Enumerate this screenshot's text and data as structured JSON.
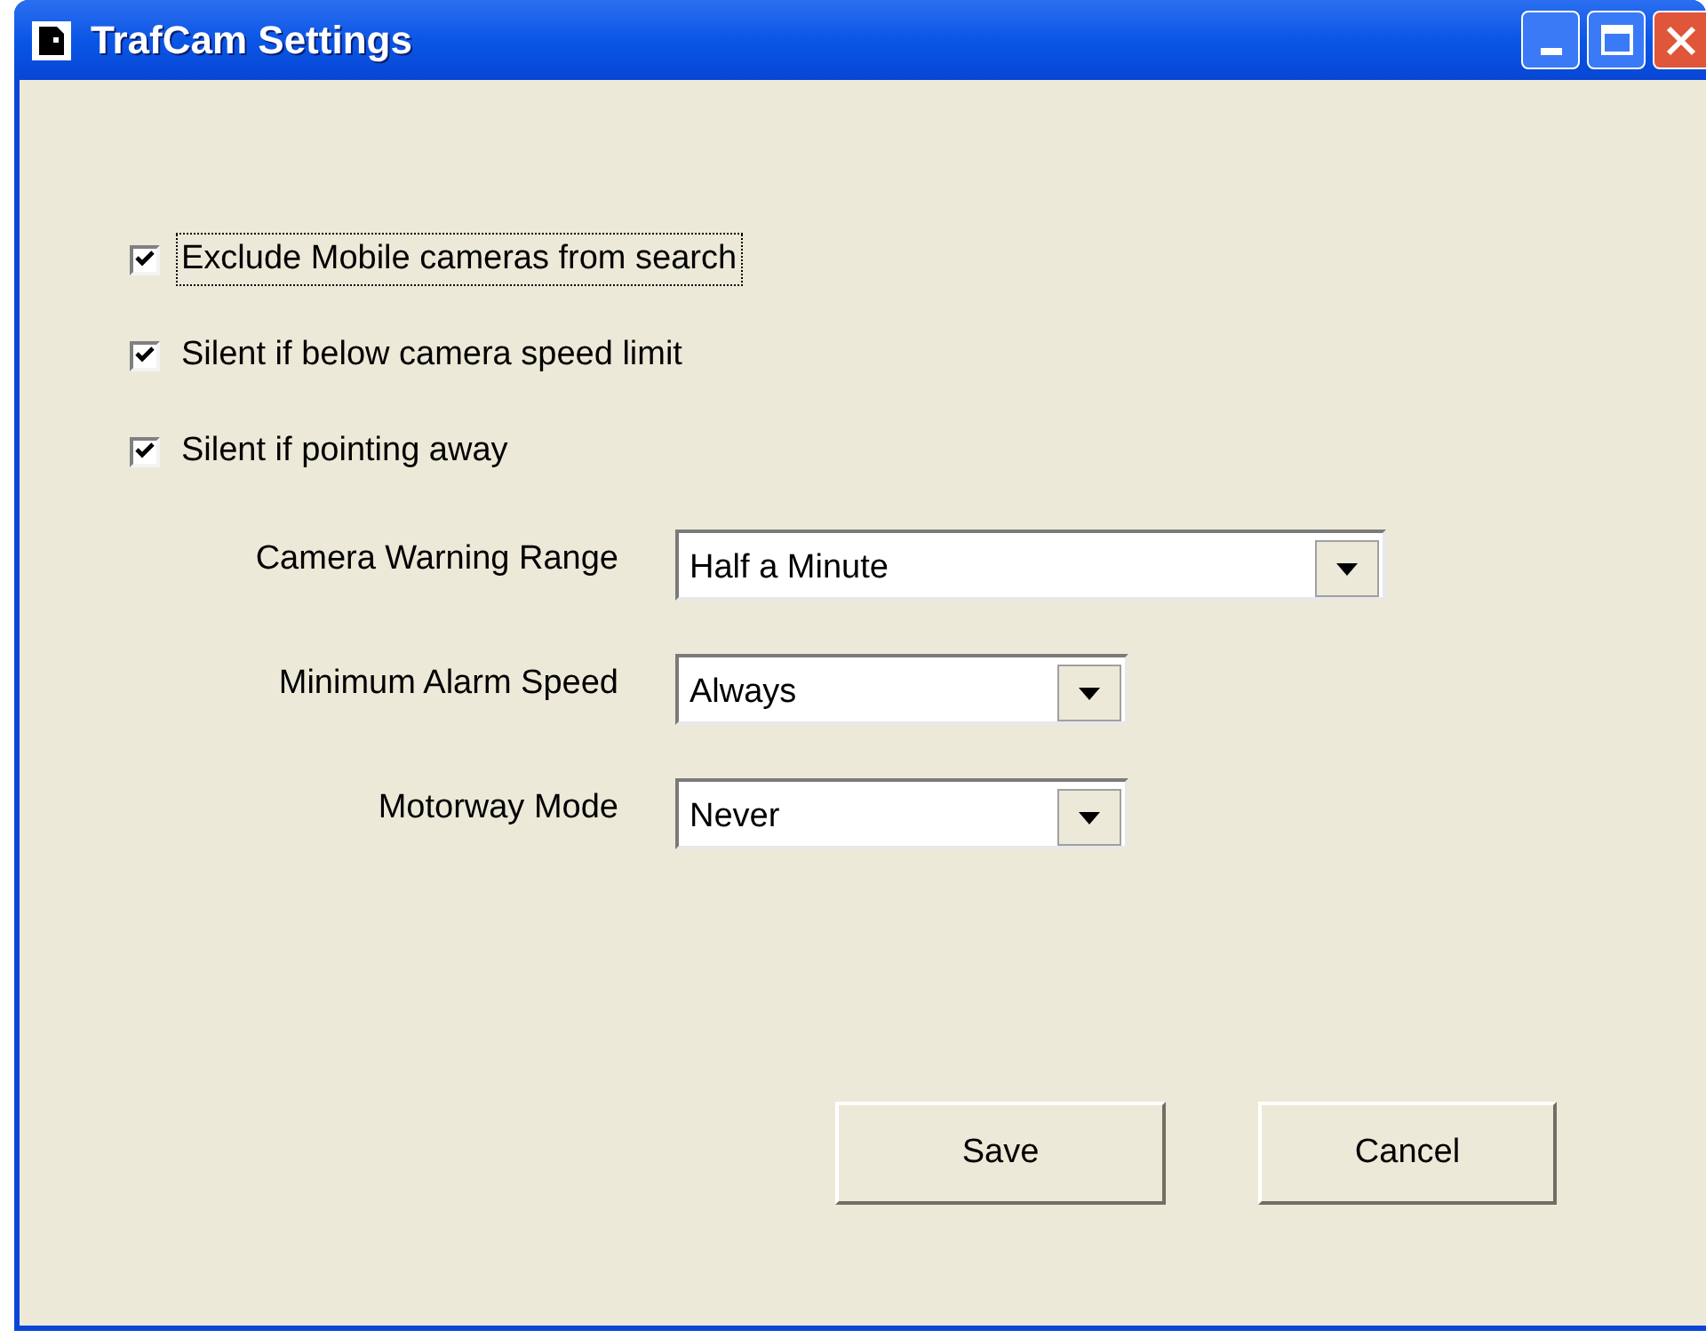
{
  "window": {
    "title": "TrafCam Settings"
  },
  "checkboxes": [
    {
      "label": "Exclude Mobile cameras from search",
      "checked": true,
      "focused": true
    },
    {
      "label": "Silent if below camera speed limit",
      "checked": true,
      "focused": false
    },
    {
      "label": "Silent if pointing away",
      "checked": true,
      "focused": false
    }
  ],
  "dropdowns": [
    {
      "label": "Camera Warning Range",
      "value": "Half a Minute",
      "wide": true
    },
    {
      "label": "Minimum Alarm Speed",
      "value": "Always",
      "wide": false
    },
    {
      "label": "Motorway Mode",
      "value": "Never",
      "wide": false
    }
  ],
  "buttons": [
    "Save",
    "Cancel"
  ]
}
